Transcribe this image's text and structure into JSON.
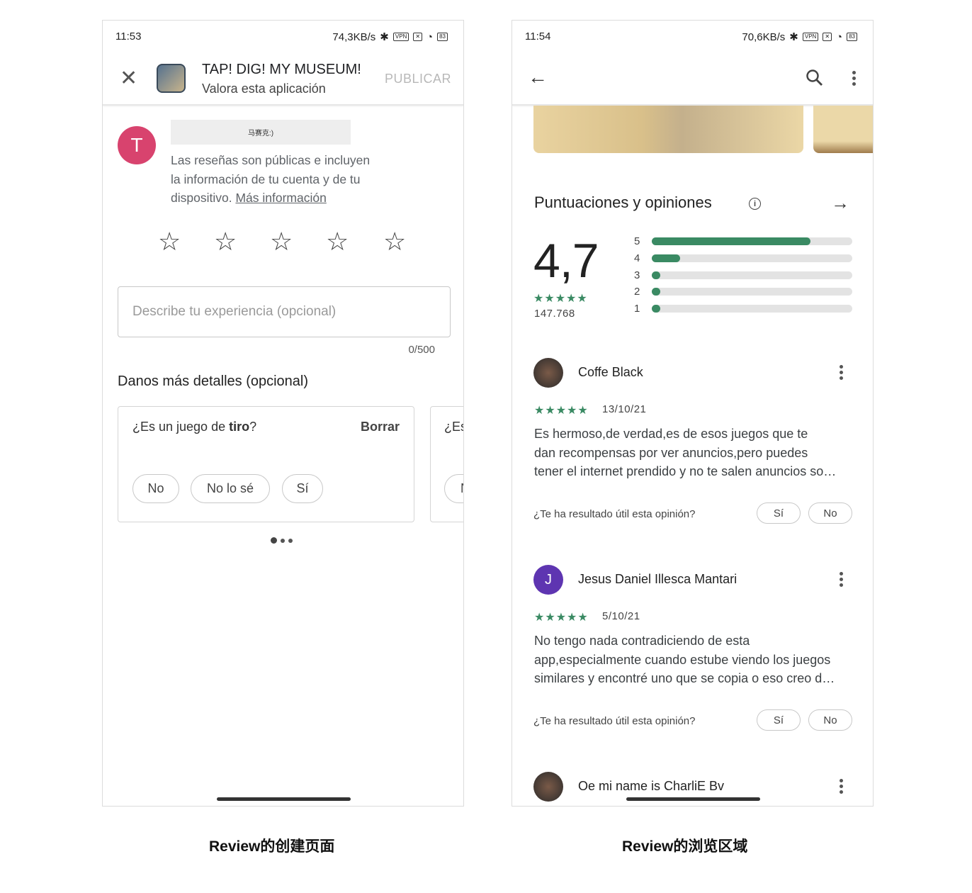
{
  "left": {
    "status": {
      "time": "11:53",
      "speed": "74,3KB/s",
      "vpn": "VPN",
      "battery": "83"
    },
    "header": {
      "title": "TAP! DIG! MY MUSEUM!",
      "subtitle": "Valora esta aplicación",
      "publish": "PUBLICAR"
    },
    "user": {
      "initial": "T",
      "avatar_color": "#d8436e",
      "name": "马赛克:)"
    },
    "notice": {
      "line1": "Las reseñas son públicas e incluyen",
      "line2": "la información de tu cuenta y de tu",
      "line3_prefix": "dispositivo. ",
      "link": "Más información"
    },
    "stars_count": 5,
    "input": {
      "placeholder": "Describe tu experiencia (opcional)",
      "counter": "0/500"
    },
    "details": {
      "title": "Danos más detalles (opcional)",
      "question_prefix": "¿Es un juego de ",
      "question_bold": "tiro",
      "question_suffix": "?",
      "clear": "Borrar",
      "options": [
        "No",
        "No lo sé",
        "Sí"
      ],
      "next_card_prefix": "¿Es",
      "next_card_option": "N"
    }
  },
  "right": {
    "status": {
      "time": "11:54",
      "speed": "70,6KB/s",
      "vpn": "VPN",
      "battery": "83"
    },
    "ratings": {
      "title": "Puntuaciones y opiniones",
      "score": "4,7",
      "count": "147.768",
      "stars": "★★★★★",
      "distribution": [
        {
          "label": "5",
          "percent": 79
        },
        {
          "label": "4",
          "percent": 14
        },
        {
          "label": "3",
          "percent": 2
        },
        {
          "label": "2",
          "percent": 1
        },
        {
          "label": "1",
          "percent": 2
        }
      ],
      "accent": "#3a8a63"
    },
    "reviews": [
      {
        "name": "Coffe Black",
        "stars": "★★★★★",
        "date": "13/10/21",
        "lines": [
          "Es hermoso,de verdad,es de esos juegos que te",
          "dan recompensas por ver anuncios,pero puedes",
          "tener el internet prendido y no te salen anuncios so…"
        ],
        "helpful": "¿Te ha resultado útil esta opinión?",
        "yes": "Sí",
        "no": "No"
      },
      {
        "name": "Jesus Daniel Illesca Mantari",
        "initial": "J",
        "avatar_color": "#5e35b1",
        "stars": "★★★★★",
        "date": "5/10/21",
        "lines": [
          "No tengo nada contradiciendo de esta",
          "app,especialmente cuando estube viendo los juegos",
          "similares y encontré uno que se copia o eso creo d…"
        ],
        "helpful": "¿Te ha resultado útil esta opinión?",
        "yes": "Sí",
        "no": "No"
      },
      {
        "name": "Oe mi name is CharliE Bv"
      }
    ]
  },
  "captions": {
    "left": "Review的创建页面",
    "right": "Review的浏览区域"
  }
}
